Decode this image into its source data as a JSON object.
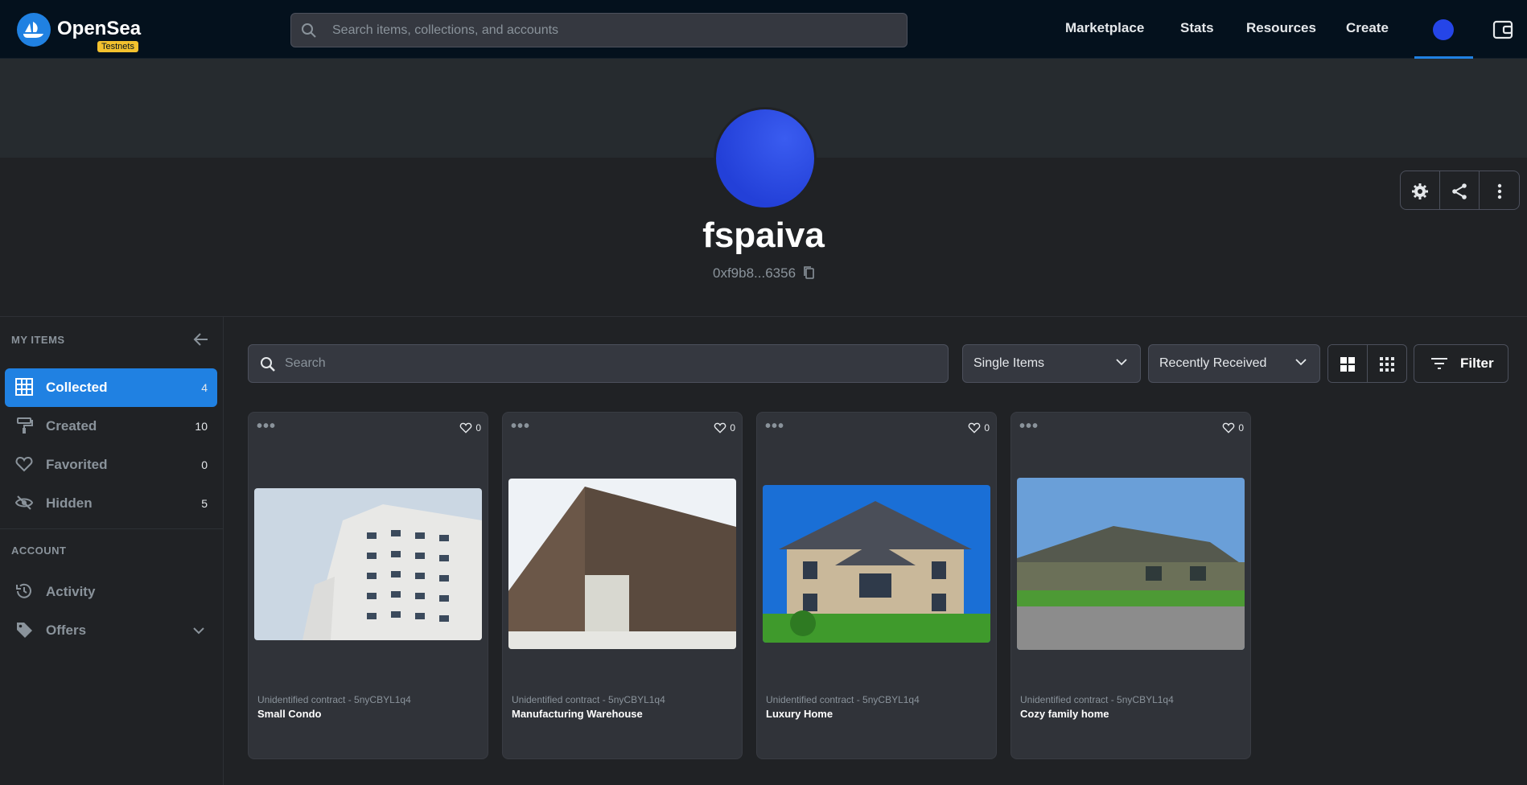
{
  "topbar": {
    "brand": "OpenSea",
    "badge": "Testnets",
    "search_placeholder": "Search items, collections, and accounts",
    "nav": [
      "Marketplace",
      "Stats",
      "Resources",
      "Create"
    ]
  },
  "profile": {
    "username": "fspaiva",
    "address": "0xf9b8...6356"
  },
  "sidebar": {
    "heading_items": "MY ITEMS",
    "items": [
      {
        "label": "Collected",
        "count": "4"
      },
      {
        "label": "Created",
        "count": "10"
      },
      {
        "label": "Favorited",
        "count": "0"
      },
      {
        "label": "Hidden",
        "count": "5"
      }
    ],
    "heading_account": "ACCOUNT",
    "account_items": [
      {
        "label": "Activity"
      },
      {
        "label": "Offers"
      }
    ]
  },
  "toolbar": {
    "search_placeholder": "Search",
    "type_select": "Single Items",
    "sort_select": "Recently Received",
    "filter_label": "Filter"
  },
  "cards": [
    {
      "contract": "Unidentified contract - 5nyCBYL1q4",
      "name": "Small Condo",
      "likes": "0"
    },
    {
      "contract": "Unidentified contract - 5nyCBYL1q4",
      "name": "Manufacturing Warehouse",
      "likes": "0"
    },
    {
      "contract": "Unidentified contract - 5nyCBYL1q4",
      "name": "Luxury Home",
      "likes": "0"
    },
    {
      "contract": "Unidentified contract - 5nyCBYL1q4",
      "name": "Cozy family home",
      "likes": "0"
    }
  ],
  "colors": {
    "accent": "#2081e2",
    "topbar": "#04111d",
    "avatar": "#2545e8",
    "badge": "#f2c12e"
  }
}
